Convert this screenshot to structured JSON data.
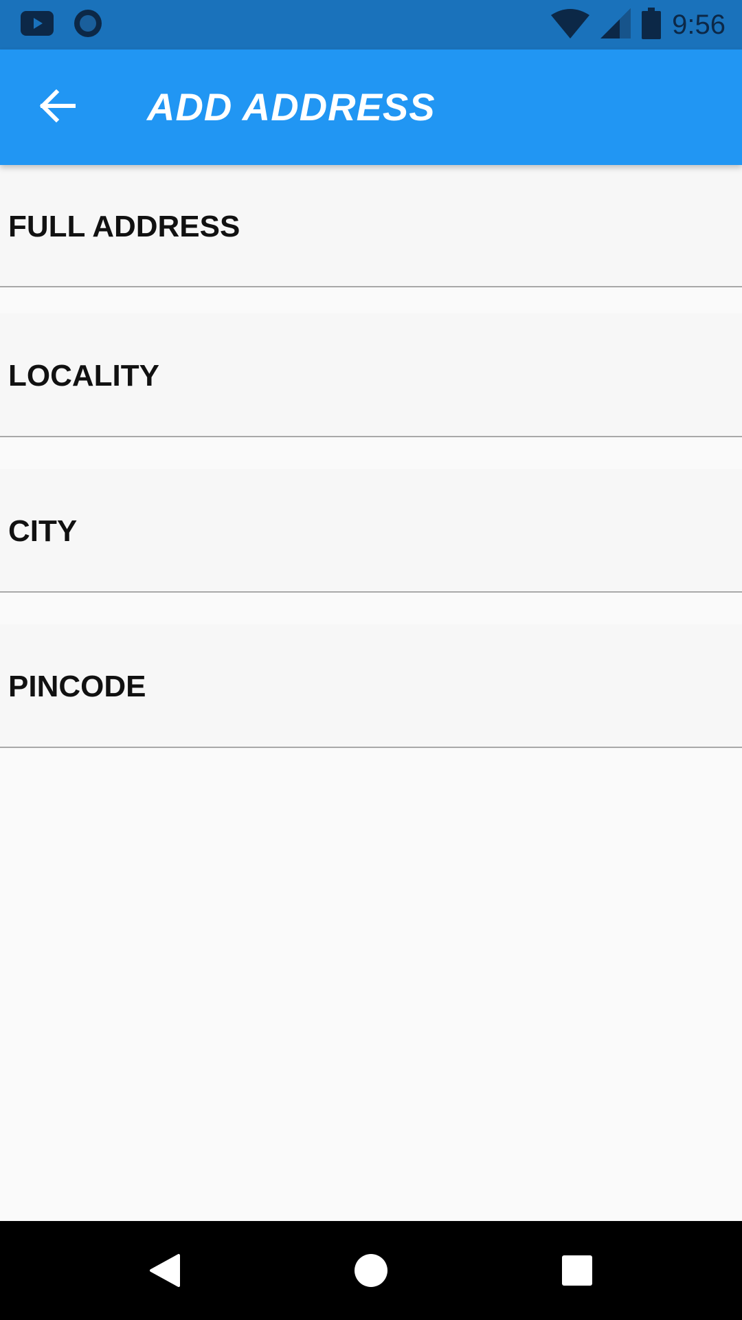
{
  "status_bar": {
    "time": "9:56",
    "icons": [
      "youtube-icon",
      "circle-app-icon",
      "wifi-icon",
      "signal-icon",
      "battery-icon"
    ]
  },
  "app_bar": {
    "title": "ADD ADDRESS",
    "back_icon": "arrow-back-icon",
    "color": "#2196f3"
  },
  "form": {
    "fields": [
      {
        "label": "FULL ADDRESS",
        "value": ""
      },
      {
        "label": "LOCALITY",
        "value": ""
      },
      {
        "label": "CITY",
        "value": ""
      },
      {
        "label": "PINCODE",
        "value": ""
      }
    ]
  },
  "nav_bar": {
    "icons": [
      "back-triangle-icon",
      "home-circle-icon",
      "recents-square-icon"
    ]
  }
}
